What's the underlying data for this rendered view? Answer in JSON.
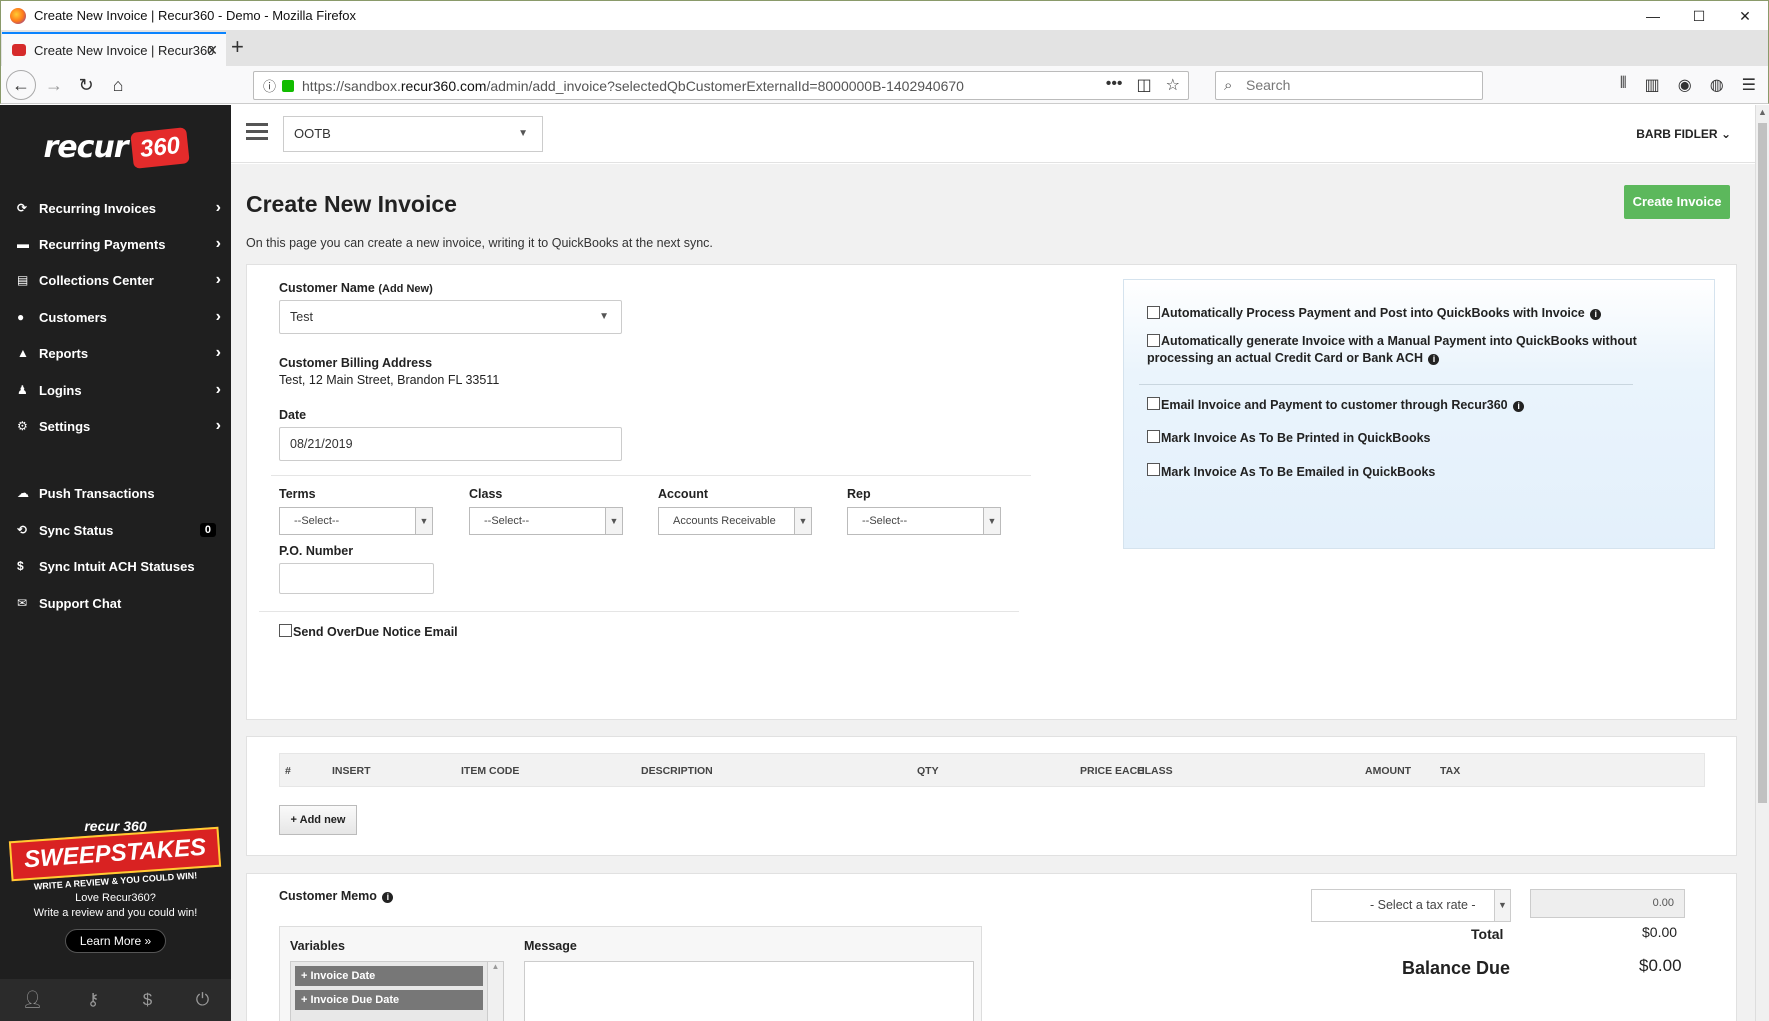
{
  "browser": {
    "window_title": "Create New Invoice | Recur360 - Demo - Mozilla Firefox",
    "tab_title": "Create New Invoice | Recur360",
    "url_prefix": "https://sandbox.",
    "url_host": "recur360.com",
    "url_path": "/admin/add_invoice?selectedQbCustomerExternalId=8000000B-1402940670",
    "search_placeholder": "Search"
  },
  "sidebar": {
    "brand": "recur",
    "brand_badge": "360",
    "items": [
      {
        "label": "Recurring Invoices",
        "icon": "refresh-icon"
      },
      {
        "label": "Recurring Payments",
        "icon": "credit-card-icon"
      },
      {
        "label": "Collections Center",
        "icon": "document-icon"
      },
      {
        "label": "Customers",
        "icon": "users-icon"
      },
      {
        "label": "Reports",
        "icon": "chart-icon"
      },
      {
        "label": "Logins",
        "icon": "user-plus-icon"
      },
      {
        "label": "Settings",
        "icon": "cogs-icon"
      },
      {
        "label": "Push Transactions",
        "icon": "cloud-upload-icon"
      },
      {
        "label": "Sync Status",
        "icon": "sync-icon",
        "count": "0"
      },
      {
        "label": "Sync Intuit ACH Statuses",
        "icon": "dollar-icon"
      },
      {
        "label": "Support Chat",
        "icon": "chat-icon"
      }
    ],
    "promo": {
      "brand": "recur 360",
      "title": "SWEEPSTAKES",
      "tagline": "WRITE A REVIEW & YOU COULD WIN!",
      "line1": "Love Recur360?",
      "line2": "Write a review and you could win!",
      "button": "Learn More »"
    }
  },
  "appbar": {
    "company": "OOTB",
    "user": "BARB FIDLER"
  },
  "page": {
    "title": "Create New Invoice",
    "subtitle": "On this page you can create a new invoice, writing it to QuickBooks at the next sync.",
    "create_button": "Create Invoice"
  },
  "form": {
    "customer_label": "Customer Name",
    "add_new": "(Add New)",
    "customer_value": "Test",
    "billing_label": "Customer Billing Address",
    "billing_value": "Test, 12 Main Street, Brandon FL 33511",
    "date_label": "Date",
    "date_value": "08/21/2019",
    "terms_label": "Terms",
    "terms_value": "--Select--",
    "class_label": "Class",
    "class_value": "--Select--",
    "account_label": "Account",
    "account_value": "Accounts Receivable",
    "rep_label": "Rep",
    "rep_value": "--Select--",
    "po_label": "P.O. Number",
    "po_value": "",
    "overdue_label": "Send OverDue Notice Email"
  },
  "options": {
    "auto_process": "Automatically Process Payment and Post into QuickBooks with Invoice",
    "auto_generate_1": "Automatically generate Invoice with a Manual Payment into QuickBooks without",
    "auto_generate_2": "processing an actual Credit Card or Bank ACH",
    "email_invoice": "Email Invoice and Payment to customer through Recur360",
    "mark_printed": "Mark Invoice As To Be Printed in QuickBooks",
    "mark_emailed": "Mark Invoice As To Be Emailed in QuickBooks"
  },
  "items_table": {
    "columns": [
      "#",
      "INSERT",
      "ITEM CODE",
      "DESCRIPTION",
      "QTY",
      "PRICE EACH",
      "CLASS",
      "AMOUNT",
      "TAX"
    ],
    "add_button": "Add new"
  },
  "memo": {
    "label": "Customer Memo",
    "variables_label": "Variables",
    "message_label": "Message",
    "variables": [
      "Invoice Date",
      "Invoice Due Date"
    ]
  },
  "totals": {
    "tax_select": "- Select a tax rate -",
    "tax_amount": "0.00",
    "total_label": "Total",
    "total_value": "$0.00",
    "balance_label": "Balance Due",
    "balance_value": "$0.00"
  }
}
